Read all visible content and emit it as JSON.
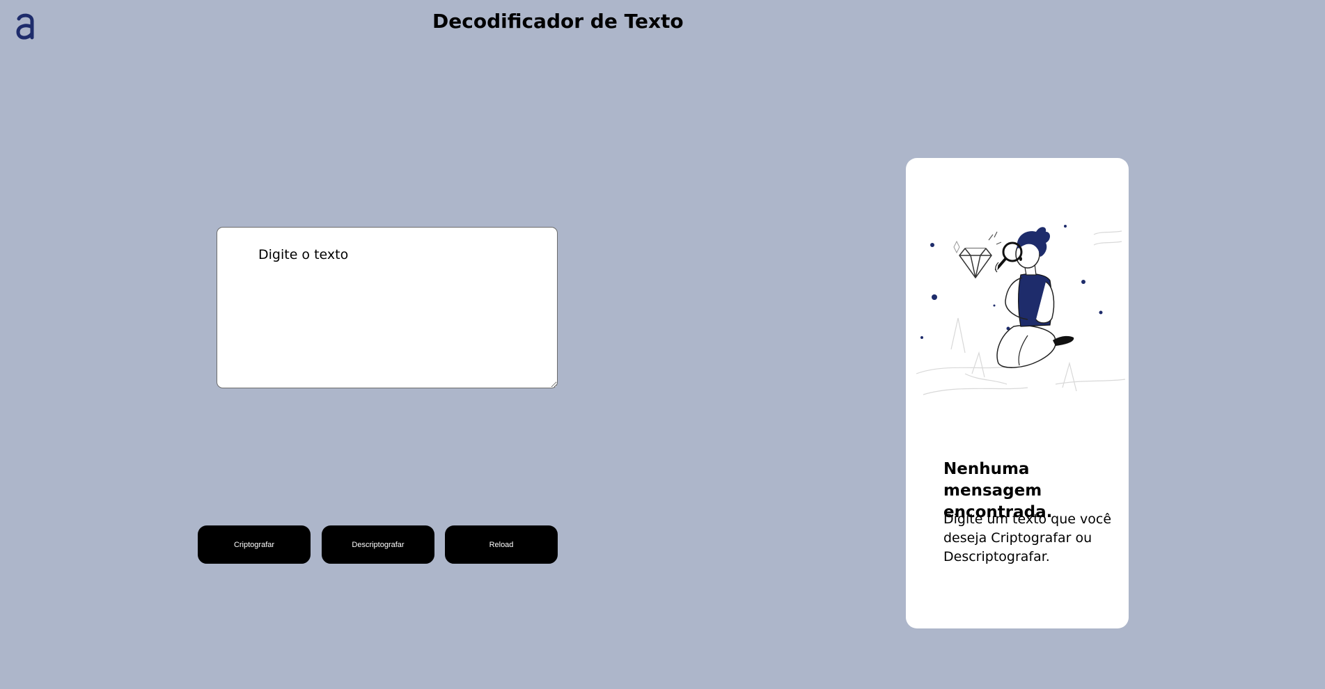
{
  "header": {
    "logo_alt": "a",
    "title": "Decodificador de Texto"
  },
  "input": {
    "placeholder": "Digite o texto",
    "value": ""
  },
  "buttons": {
    "encrypt_label": "Criptografar",
    "decrypt_label": "Descriptografar",
    "reload_label": "Reload"
  },
  "output": {
    "illustration_icon": "person-magnifying-glass-illustration",
    "empty_title": "Nenhuma mensagem encontrada.",
    "empty_description": "Digite um texto que você deseja Criptografar ou Descriptografar."
  },
  "colors": {
    "background": "#adb6ca",
    "brand": "#1e2c6b",
    "button": "#000000",
    "card": "#ffffff"
  }
}
